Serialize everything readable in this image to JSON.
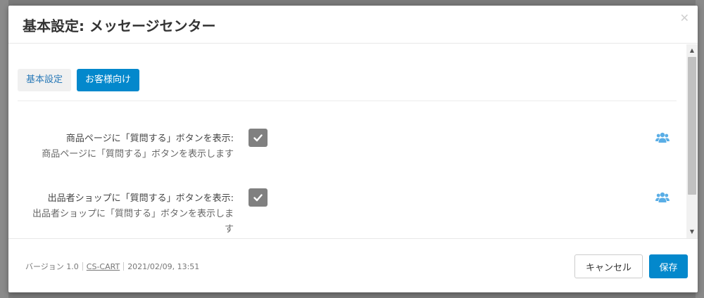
{
  "modal": {
    "title": "基本設定: メッセージセンター",
    "close_icon": "close-icon"
  },
  "tabs": [
    {
      "label": "基本設定",
      "active": false
    },
    {
      "label": "お客様向け",
      "active": true
    }
  ],
  "settings": [
    {
      "label": "商品ページに「質問する」ボタンを表示:",
      "description": "商品ページに「質問する」ボタンを表示します",
      "checked": true,
      "icon": "users-icon"
    },
    {
      "label": "出品者ショップに「質問する」ボタンを表示:",
      "description": "出品者ショップに「質問する」ボタンを表示しま す",
      "description_line1": "出品者ショップに「質問する」ボタンを表示しま",
      "description_line2": "す",
      "checked": true,
      "icon": "users-icon"
    }
  ],
  "footer": {
    "version": "バージョン 1.0",
    "vendor_link": "CS-CART",
    "date": "2021/02/09, 13:51",
    "cancel_label": "キャンセル",
    "save_label": "保存"
  },
  "colors": {
    "primary": "#0388cc",
    "checkbox": "#808080",
    "users_icon": "#5aaee6"
  }
}
